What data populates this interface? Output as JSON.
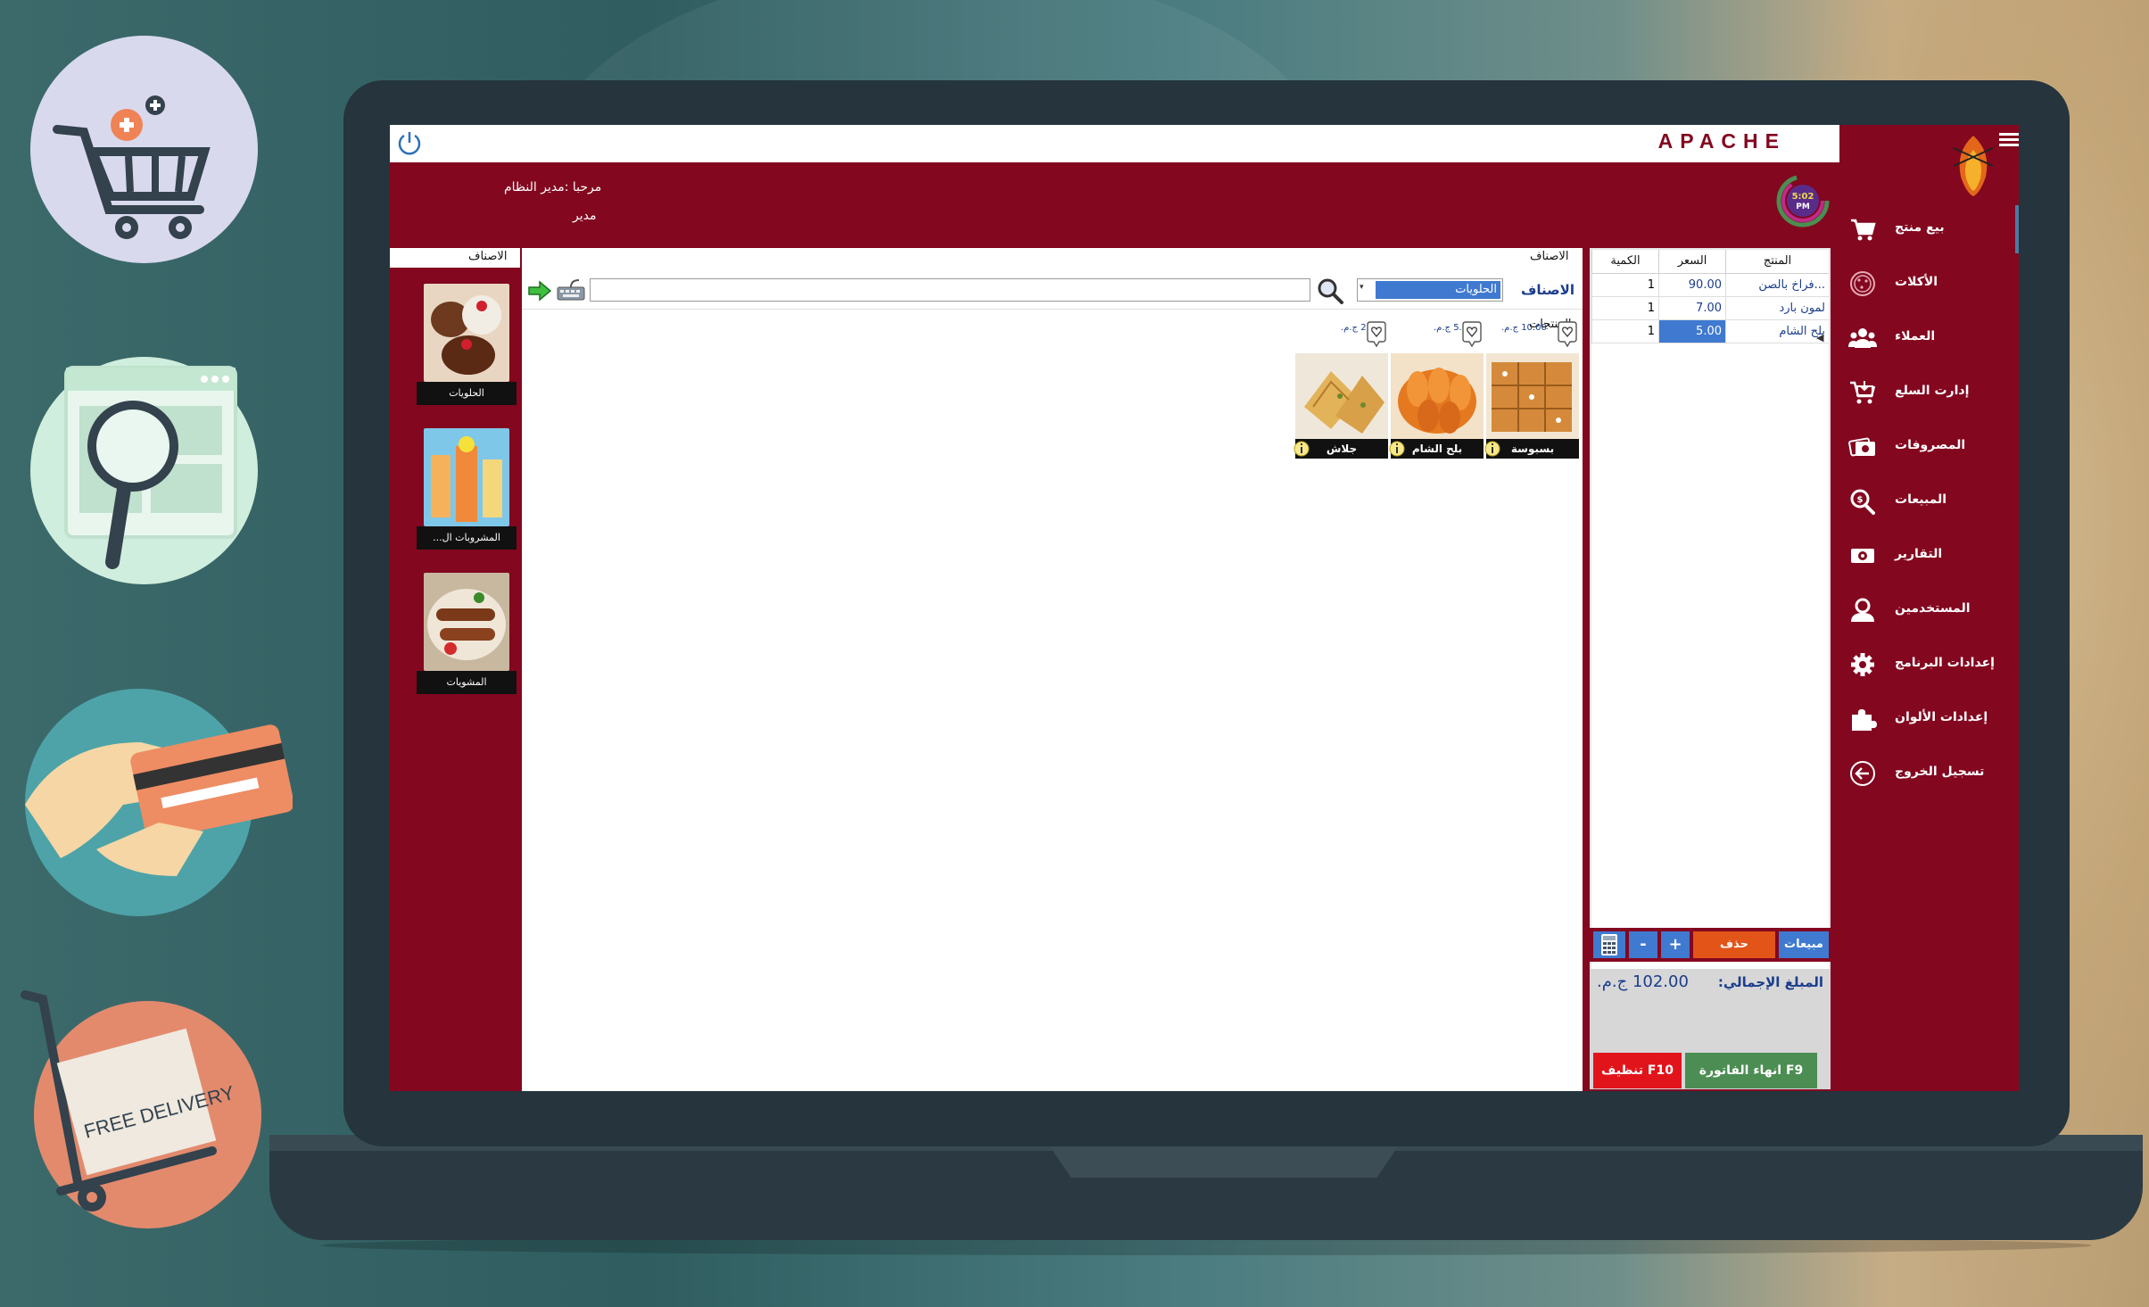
{
  "app": {
    "brand": "APACHE"
  },
  "header": {
    "welcome": "مرحبا :مدير النظام",
    "role": "مدير",
    "clock_time": "5:02",
    "clock_ampm": "PM"
  },
  "sidebar": {
    "items": [
      {
        "label": "بيع منتج",
        "icon": "cart-icon"
      },
      {
        "label": "الأكلات",
        "icon": "pizza-icon"
      },
      {
        "label": "العملاء",
        "icon": "users-icon"
      },
      {
        "label": "إدارت السلع",
        "icon": "cart-download-icon"
      },
      {
        "label": "المصروفات",
        "icon": "money-icon"
      },
      {
        "label": "المبيعات",
        "icon": "search-sales-icon"
      },
      {
        "label": "التقارير",
        "icon": "reports-icon"
      },
      {
        "label": "المستخدمين",
        "icon": "user-icon"
      },
      {
        "label": "إعدادات البرنامج",
        "icon": "gear-icon"
      },
      {
        "label": "إعدادات الألوان",
        "icon": "puzzle-icon"
      },
      {
        "label": "تسجيل الخروج",
        "icon": "logout-icon"
      }
    ]
  },
  "cart": {
    "headers": {
      "product": "المنتج",
      "price": "السعر",
      "qty": "الكمية"
    },
    "rows": [
      {
        "product": "فراخ بالصن...",
        "price": "90.00",
        "qty": "1"
      },
      {
        "product": "لمون بارد",
        "price": "7.00",
        "qty": "1"
      },
      {
        "product": "بلح الشام",
        "price": "5.00",
        "qty": "1"
      }
    ],
    "buttons": {
      "sales": "مبيعات",
      "delete": "حذف",
      "plus": "+",
      "minus": "-"
    },
    "total_label": "المبلغ الإجمالي:",
    "total_value": "102.00 ج.م.",
    "end_invoice": "انهاء الفاتورة   F9",
    "clear": "تنظيف   F10"
  },
  "products_panel": {
    "section_label": "الاصناف",
    "category_label": "الاصناف",
    "category_value": "الحلويات",
    "search_value": "",
    "products_label": "المنتجات",
    "products": [
      {
        "name": "بسبوسة",
        "price": "10.00 ج.م."
      },
      {
        "name": "بلح الشام",
        "price": "5.00 ج.م."
      },
      {
        "name": "جلاش",
        "price": "2.00 ج.م."
      }
    ]
  },
  "categories": {
    "title": "الاصناف",
    "items": [
      {
        "name": "الحلويات"
      },
      {
        "name": "المشروبات ال..."
      },
      {
        "name": "المشويات"
      }
    ]
  },
  "promos": [
    {
      "icon": "shopping-cart-add-icon",
      "color": "#d9d9ee"
    },
    {
      "icon": "browser-search-icon",
      "color": "#cfeedd"
    },
    {
      "icon": "credit-card-hand-icon",
      "color": "#4ea3a8"
    },
    {
      "icon": "free-delivery-icon",
      "color": "#e38a6d",
      "text": "FREE DELIVERY"
    }
  ],
  "colors": {
    "primary": "#83071f",
    "accent": "#3f7ad0",
    "success": "#4b8d52",
    "danger": "#e1141c"
  }
}
